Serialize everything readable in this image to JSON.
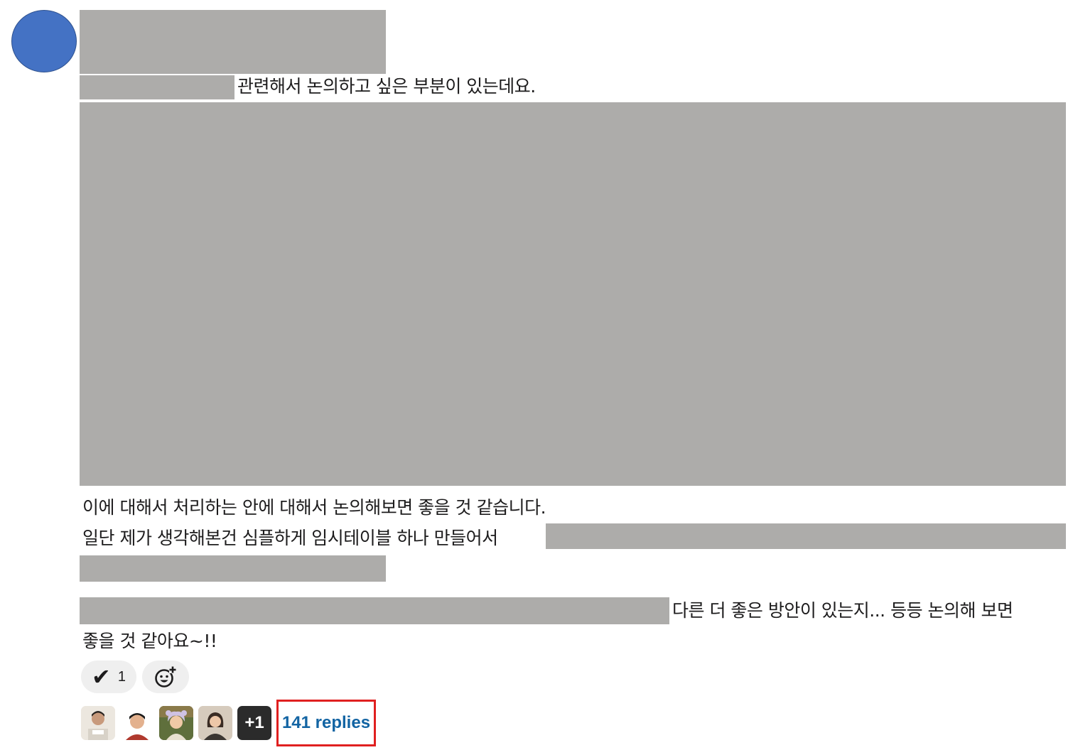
{
  "message": {
    "line1_text": "관련해서 논의하고 싶은 부분이 있는데요.",
    "line2_text": "이에 대해서 처리하는 안에 대해서 논의해보면 좋을 것 같습니다.",
    "line3_text": "일단 제가 생각해본건 심플하게 임시테이블 하나 만들어서",
    "line4_text": "다른 더 좋은 방안이 있는지... 등등 논의해 보면",
    "line5_text": "좋을 것 같아요~!!"
  },
  "reactions": [
    {
      "icon": "check-icon",
      "count": "1"
    },
    {
      "icon": "add-reaction-icon"
    }
  ],
  "thread": {
    "participants": [
      "participant-avatar-1",
      "participant-avatar-2",
      "participant-avatar-3",
      "participant-avatar-4"
    ],
    "more_label": "+1",
    "replies_label": "141 replies"
  },
  "colors": {
    "avatar": "#4472c4",
    "redaction": "#adacaa",
    "link": "#1264a3",
    "highlight_box": "#e02020"
  }
}
